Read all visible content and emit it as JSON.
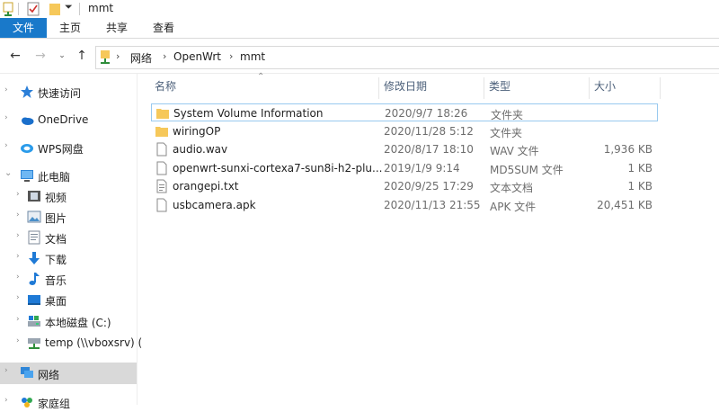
{
  "window": {
    "title": "mmt"
  },
  "ribbon": {
    "tabs": [
      {
        "label": "文件"
      },
      {
        "label": "主页"
      },
      {
        "label": "共享"
      },
      {
        "label": "查看"
      }
    ]
  },
  "address": {
    "crumbs": [
      "网络",
      "OpenWrt",
      "mmt"
    ]
  },
  "sidebar": {
    "items": [
      {
        "label": "快速访问",
        "icon": "star-icon"
      },
      {
        "label": "OneDrive",
        "icon": "cloud-icon"
      },
      {
        "label": "WPS网盘",
        "icon": "wps-cloud-icon"
      },
      {
        "label": "此电脑",
        "icon": "computer-icon"
      },
      {
        "label": "视频",
        "icon": "video-icon"
      },
      {
        "label": "图片",
        "icon": "picture-icon"
      },
      {
        "label": "文档",
        "icon": "document-icon"
      },
      {
        "label": "下载",
        "icon": "download-icon"
      },
      {
        "label": "音乐",
        "icon": "music-icon"
      },
      {
        "label": "桌面",
        "icon": "desktop-icon"
      },
      {
        "label": "本地磁盘 (C:)",
        "icon": "drive-icon"
      },
      {
        "label": "temp (\\\\vboxsrv) (",
        "icon": "network-drive-icon"
      },
      {
        "label": "网络",
        "icon": "network-icon"
      },
      {
        "label": "家庭组",
        "icon": "homegroup-icon"
      }
    ]
  },
  "columns": {
    "name": "名称",
    "date": "修改日期",
    "type": "类型",
    "size": "大小"
  },
  "files": [
    {
      "name": "System Volume Information",
      "date": "2020/9/7 18:26",
      "type": "文件夹",
      "size": "",
      "icon": "folder-icon"
    },
    {
      "name": "wiringOP",
      "date": "2020/11/28 5:12",
      "type": "文件夹",
      "size": "",
      "icon": "folder-icon"
    },
    {
      "name": "audio.wav",
      "date": "2020/8/17 18:10",
      "type": "WAV 文件",
      "size": "1,936 KB",
      "icon": "file-icon"
    },
    {
      "name": "openwrt-sunxi-cortexa7-sun8i-h2-plu...",
      "date": "2019/1/9 9:14",
      "type": "MD5SUM 文件",
      "size": "1 KB",
      "icon": "file-icon"
    },
    {
      "name": "orangepi.txt",
      "date": "2020/9/25 17:29",
      "type": "文本文档",
      "size": "1 KB",
      "icon": "text-file-icon"
    },
    {
      "name": "usbcamera.apk",
      "date": "2020/11/13 21:55",
      "type": "APK 文件",
      "size": "20,451 KB",
      "icon": "file-icon"
    }
  ],
  "colors": {
    "accent": "#1979ca",
    "folder": "#f6c85a",
    "selection_border": "#99c9ef",
    "nav_selected": "#d9d9d9"
  }
}
